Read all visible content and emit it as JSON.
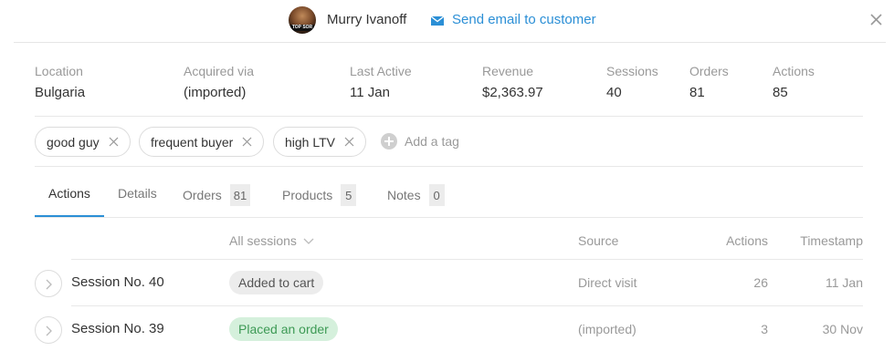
{
  "header": {
    "avatar_badge": "TOP SOR",
    "customer_name": "Murry Ivanoff",
    "email_link": "Send email to customer",
    "accent_color": "#2b8fd6"
  },
  "stats": {
    "location": {
      "label": "Location",
      "value": "Bulgaria"
    },
    "acquired": {
      "label": "Acquired via",
      "value": "(imported)"
    },
    "last_active": {
      "label": "Last Active",
      "value": "11 Jan"
    },
    "revenue": {
      "label": "Revenue",
      "value": "$2,363.97"
    },
    "sessions": {
      "label": "Sessions",
      "value": "40"
    },
    "orders": {
      "label": "Orders",
      "value": "81"
    },
    "actions": {
      "label": "Actions",
      "value": "85"
    }
  },
  "tags": [
    "good guy",
    "frequent buyer",
    "high LTV"
  ],
  "add_tag_label": "Add a tag",
  "tabs": [
    {
      "label": "Actions",
      "count": null,
      "active": true
    },
    {
      "label": "Details",
      "count": null
    },
    {
      "label": "Orders",
      "count": "81"
    },
    {
      "label": "Products",
      "count": "5"
    },
    {
      "label": "Notes",
      "count": "0"
    }
  ],
  "table": {
    "columns": {
      "filter": "All sessions",
      "source": "Source",
      "actions": "Actions",
      "timestamp": "Timestamp"
    },
    "rows": [
      {
        "name": "Session No. 40",
        "status": "Added to cart",
        "status_color": "#ececec",
        "source": "Direct visit",
        "actions": "26",
        "timestamp": "11 Jan"
      },
      {
        "name": "Session No. 39",
        "status": "Placed an order",
        "status_color": "#d5f0dc",
        "source": "(imported)",
        "actions": "3",
        "timestamp": "30 Nov"
      }
    ]
  }
}
